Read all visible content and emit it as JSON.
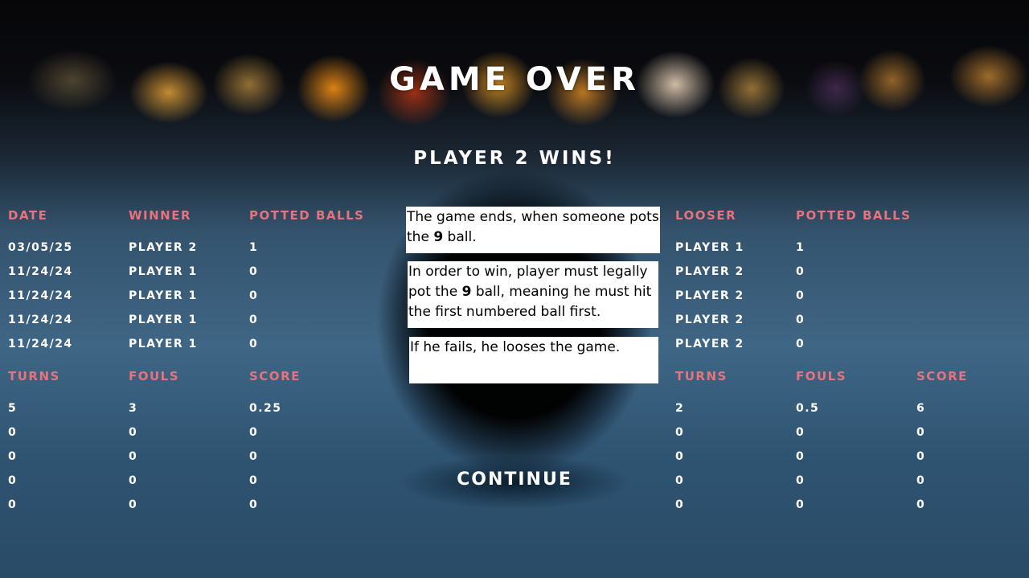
{
  "header": {
    "title": "GAME OVER",
    "result": "PLAYER 2 WINS!"
  },
  "left_table": {
    "headers": {
      "date": "DATE",
      "winner": "WINNER",
      "potted": "POTTED BALLS"
    },
    "rows": [
      {
        "date": "03/05/25",
        "winner": "PLAYER 2",
        "potted": "1"
      },
      {
        "date": "11/24/24",
        "winner": "PLAYER 1",
        "potted": "0"
      },
      {
        "date": "11/24/24",
        "winner": "PLAYER 1",
        "potted": "0"
      },
      {
        "date": "11/24/24",
        "winner": "PLAYER 1",
        "potted": "0"
      },
      {
        "date": "11/24/24",
        "winner": "PLAYER 1",
        "potted": "0"
      }
    ],
    "stats_headers": {
      "turns": "TURNS",
      "fouls": "FOULS",
      "score": "SCORE"
    },
    "stats_rows": [
      {
        "turns": "5",
        "fouls": "3",
        "score": "0.25"
      },
      {
        "turns": "0",
        "fouls": "0",
        "score": "0"
      },
      {
        "turns": "0",
        "fouls": "0",
        "score": "0"
      },
      {
        "turns": "0",
        "fouls": "0",
        "score": "0"
      },
      {
        "turns": "0",
        "fouls": "0",
        "score": "0"
      }
    ]
  },
  "right_table": {
    "headers": {
      "looser": "LOOSER",
      "potted": "POTTED BALLS"
    },
    "rows": [
      {
        "looser": "PLAYER 1",
        "potted": "1"
      },
      {
        "looser": "PLAYER 2",
        "potted": "0"
      },
      {
        "looser": "PLAYER 2",
        "potted": "0"
      },
      {
        "looser": "PLAYER 2",
        "potted": "0"
      },
      {
        "looser": "PLAYER 2",
        "potted": "0"
      }
    ],
    "stats_headers": {
      "turns": "TURNS",
      "fouls": "FOULS",
      "score": "SCORE"
    },
    "stats_rows": [
      {
        "turns": "2",
        "fouls": "0.5",
        "score": "6"
      },
      {
        "turns": "0",
        "fouls": "0",
        "score": "0"
      },
      {
        "turns": "0",
        "fouls": "0",
        "score": "0"
      },
      {
        "turns": "0",
        "fouls": "0",
        "score": "0"
      },
      {
        "turns": "0",
        "fouls": "0",
        "score": "0"
      }
    ]
  },
  "rules": {
    "box1": {
      "before": "The game ends, when someone pots the ",
      "bold": "9",
      "after": " ball."
    },
    "box2": {
      "before": "In order to win, player must legally pot the ",
      "bold": "9",
      "after": " ball, meaning he must hit the first numbered ball first."
    },
    "box3": {
      "text": "If he fails, he looses the game."
    }
  },
  "actions": {
    "continue": "CONTINUE"
  },
  "colors": {
    "header_accent": "#e8737a",
    "text": "#ffffff"
  }
}
